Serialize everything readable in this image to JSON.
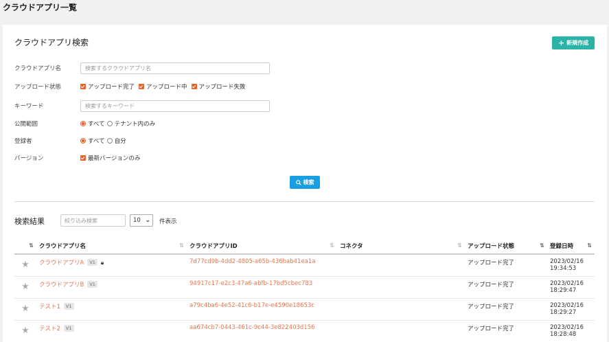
{
  "page": {
    "title": "クラウドアプリ一覧"
  },
  "search": {
    "title": "クラウドアプリ検索",
    "new_button": "新規作成",
    "fields": {
      "app_name_label": "クラウドアプリ名",
      "app_name_placeholder": "検索するクラウドアプリ名",
      "upload_status_label": "アップロード状態",
      "upload_status_options": [
        "アップロード完了",
        "アップロード中",
        "アップロード失敗"
      ],
      "keyword_label": "キーワード",
      "keyword_placeholder": "検索するキーワード",
      "scope_label": "公開範囲",
      "scope_options": [
        "すべて",
        "テナント内のみ"
      ],
      "registrant_label": "登録者",
      "registrant_options": [
        "すべて",
        "自分"
      ],
      "version_label": "バージョン",
      "version_option": "最新バージョンのみ"
    },
    "search_button": "検索"
  },
  "results": {
    "title": "検索結果",
    "filter_placeholder": "絞り込み検索",
    "page_size": "10",
    "page_size_suffix": "件表示",
    "columns": [
      "クラウドアプリ名",
      "クラウドアプリID",
      "コネクタ",
      "アップロード状態",
      "登録日時"
    ],
    "rows": [
      {
        "name": "クラウドアプリA",
        "version": "V1",
        "locked": true,
        "id": "7d77cd9b-4dd2-4805-a65b-436bab41ea1a",
        "connector": "",
        "status": "アップロード完了",
        "date": "2023/02/16",
        "time": "19:34:53"
      },
      {
        "name": "クラウドアプリB",
        "version": "V1",
        "locked": false,
        "id": "94917c17-e2c3-47a6-abfb-17bd5cbec783",
        "connector": "",
        "status": "アップロード完了",
        "date": "2023/02/16",
        "time": "18:29:47"
      },
      {
        "name": "テスト1",
        "version": "V1",
        "locked": false,
        "id": "a79c4ba6-4e52-41c6-b17e-e4590e18653c",
        "connector": "",
        "status": "アップロード完了",
        "date": "2023/02/16",
        "time": "18:29:27"
      },
      {
        "name": "テスト2",
        "version": "V1",
        "locked": false,
        "id": "aa674cb7-0443-461c-9c44-3e822403d156",
        "connector": "",
        "status": "アップロード完了",
        "date": "2023/02/16",
        "time": "18:28:48"
      }
    ]
  },
  "colors": {
    "accent": "#e8632c",
    "new_button": "#2bb3a8",
    "search_button": "#1a9ee2",
    "link": "#e8734a"
  }
}
